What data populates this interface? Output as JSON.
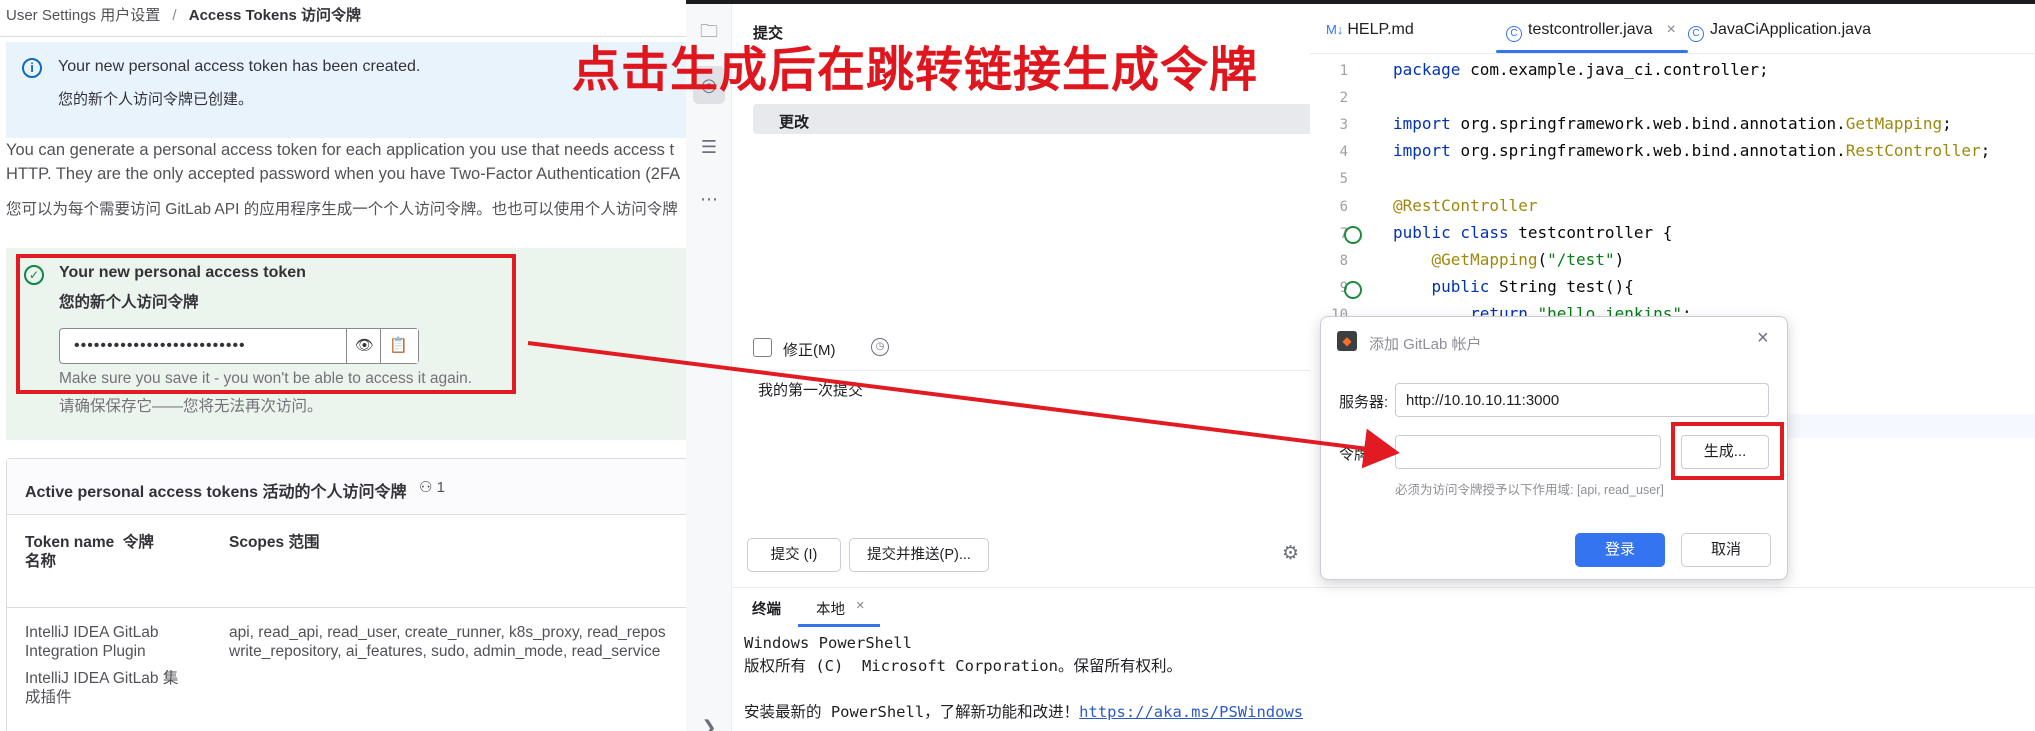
{
  "gitlab": {
    "breadcrumb": {
      "user_settings": "User Settings",
      "user_settings_zh": "用户设置",
      "separator": "/",
      "current": "Access Tokens",
      "current_zh": "访问令牌"
    },
    "alert": {
      "title": "Your new personal access token has been created.",
      "title_zh": "您的新个人访问令牌已创建。"
    },
    "description": {
      "line1": "You can generate a personal access token for each application you use that needs access t",
      "line2": "HTTP. They are the only accepted password when you have Two-Factor Authentication (2FA",
      "line3": "您可以为每个需要访问 GitLab API 的应用程序生成一个个人访问令牌。也也可以使用个人访问令牌"
    },
    "new_token": {
      "title": "Your new personal access token",
      "title_zh": "您的新个人访问令牌",
      "masked_value": "••••••••••••••••••••••••••",
      "note": "Make sure you save it - you won't be able to access it again.",
      "note_zh": "请确保保存它——您将无法再次访问。"
    },
    "active_tokens": {
      "title": "Active personal access tokens  活动的个人访问令牌",
      "count": "1",
      "col_name": "Token name  令牌\n名称",
      "col_scopes": "Scopes  范围",
      "row": {
        "name": "IntelliJ IDEA GitLab\nIntegration Plugin",
        "name_zh": "IntelliJ IDEA GitLab 集\n成插件",
        "scopes_1": "api, read_api, read_user, create_runner, k8s_proxy, read_repos",
        "scopes_2": "write_repository, ai_features, sudo, admin_mode, read_service"
      }
    }
  },
  "ide": {
    "commit": {
      "title": "提交",
      "changes": "更改",
      "amend": "修正(M)",
      "message": "我的第一次提交",
      "commit_btn": "提交 (I)",
      "commit_push_btn": "提交并推送(P)..."
    },
    "terminal": {
      "tab_terminal": "终端",
      "tab_local": "本地",
      "close": "×",
      "line1": "Windows PowerShell",
      "line2": "版权所有 (C)  Microsoft Corporation。保留所有权利。",
      "line3_prefix": "安装最新的 PowerShell，了解新功能和改进！",
      "line3_link": "https://aka.ms/PSWindows"
    },
    "editor": {
      "tabs": [
        {
          "icon": "M↓",
          "label": "HELP.md"
        },
        {
          "icon": "C",
          "label": "testcontroller.java",
          "close": "×"
        },
        {
          "icon": "C",
          "label": "JavaCiApplication.java"
        }
      ],
      "lines": [
        "1",
        "2",
        "3",
        "4",
        "5",
        "6",
        "7",
        "8",
        "9",
        "10"
      ],
      "code": {
        "l1_kw": "package ",
        "l1_rest": "com.example.java_ci.controller;",
        "l3_kw": "import ",
        "l3_rest": "org.springframework.web.bind.annotation.",
        "l3_cls": "GetMapping",
        "l3_end": ";",
        "l4_kw": "import ",
        "l4_rest": "org.springframework.web.bind.annotation.",
        "l4_cls": "RestController",
        "l4_end": ";",
        "l6_an": "@RestController",
        "l7_kw": "public class ",
        "l7_rest": "testcontroller {",
        "l8_an": "    @GetMapping",
        "l8_p1": "(",
        "l8_st": "\"/test\"",
        "l8_p2": ")",
        "l9_kw": "    public ",
        "l9_rest": "String test(){",
        "l10_kw": "        return ",
        "l10_st": "\"hello jenkins\"",
        "l10_end": ";"
      }
    },
    "dialog": {
      "title": "添加 GitLab 帐户",
      "server_label": "服务器:",
      "server_value": "http://10.10.10.11:3000",
      "token_label": "令牌:",
      "generate_btn": "生成...",
      "hint": "必须为访问令牌授予以下作用域: [api, read_user]",
      "login_btn": "登录",
      "cancel_btn": "取消"
    }
  },
  "annotation": {
    "text": "点击生成后在跳转链接生成令牌",
    "color": "#e21b23"
  }
}
